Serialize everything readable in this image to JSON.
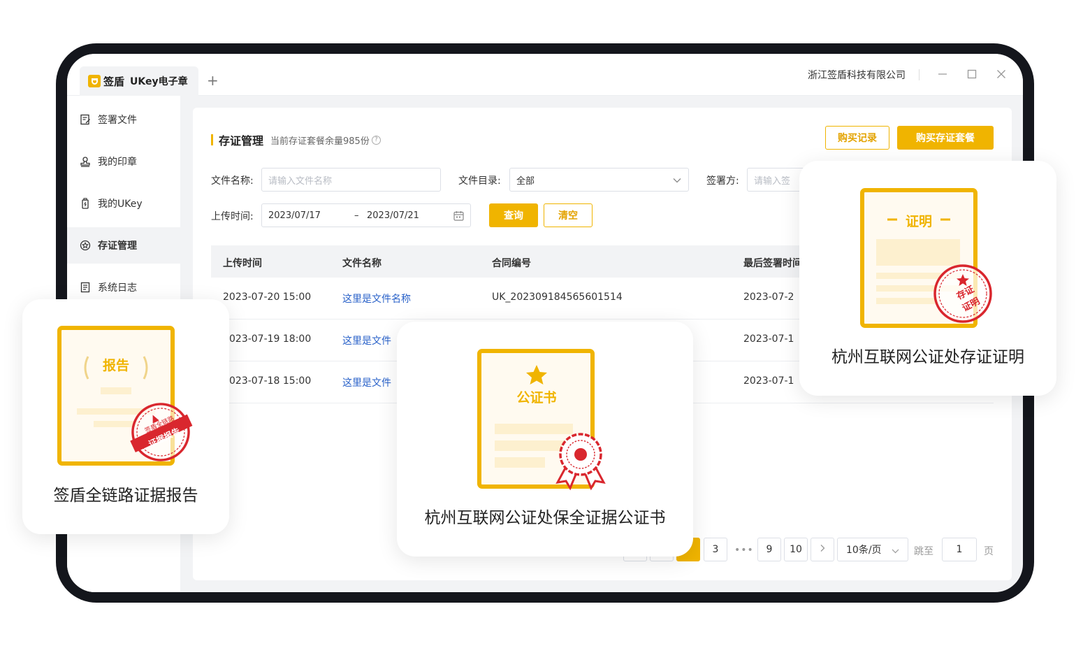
{
  "window": {
    "tab_brand": "签盾",
    "tab_title": "UKey电子章",
    "add_tab": "+",
    "company": "浙江签盾科技有限公司"
  },
  "sidebar": {
    "items": [
      {
        "label": "签署文件",
        "icon": "sign-document-icon"
      },
      {
        "label": "我的印章",
        "icon": "seal-icon"
      },
      {
        "label": "我的UKey",
        "icon": "ukey-icon"
      },
      {
        "label": "存证管理",
        "icon": "evidence-icon"
      },
      {
        "label": "系统日志",
        "icon": "log-icon"
      }
    ],
    "active": "存证管理"
  },
  "page": {
    "title": "存证管理",
    "subtitle": "当前存证套餐余量985份",
    "buy_records": "购买记录",
    "buy_package": "购买存证套餐"
  },
  "filters": {
    "file_name_label": "文件名称:",
    "file_name_placeholder": "请输入文件名称",
    "directory_label": "文件目录:",
    "directory_value": "全部",
    "signer_label": "签署方:",
    "signer_placeholder": "请输入签",
    "upload_time_label": "上传时间:",
    "date_start": "2023/07/17",
    "date_sep": "–",
    "date_end": "2023/07/21",
    "search": "查询",
    "clear": "清空"
  },
  "table": {
    "headers": [
      "上传时间",
      "文件名称",
      "合同编号",
      "最后签署时间"
    ],
    "rows": [
      {
        "upload_time": "2023-07-20 15:00",
        "file_name": "这里是文件名称",
        "contract_no": "UK_202309184565601514",
        "last_signed": "2023-07-2"
      },
      {
        "upload_time": "023-07-19 18:00",
        "file_name": "这里是文件",
        "contract_no": "",
        "last_signed": "2023-07-1"
      },
      {
        "upload_time": "023-07-18 15:00",
        "file_name": "这里是文件",
        "contract_no": "",
        "last_signed": "2023-07-1"
      }
    ]
  },
  "pagination": {
    "pages": [
      "3",
      "9",
      "10"
    ],
    "ellipsis": "•••",
    "page_size": "10条/页",
    "jump_label": "跳至",
    "jump_value": "1",
    "page_suffix": "页"
  },
  "cards": {
    "report": {
      "caption": "签盾全链路证据报告",
      "doc_title": "报告",
      "stamp_top": "签盾全链路",
      "stamp_band": "证据报告"
    },
    "notary": {
      "caption": "杭州互联网公证处保全证据公证书",
      "doc_title": "公证书"
    },
    "proof": {
      "caption": "杭州互联网公证处存证证明",
      "doc_title": "证明",
      "stamp_line1": "存证",
      "stamp_line2": "证明"
    }
  },
  "colors": {
    "accent": "#f0b400",
    "link": "#2a62c9",
    "stamp_red": "#d9272e"
  }
}
